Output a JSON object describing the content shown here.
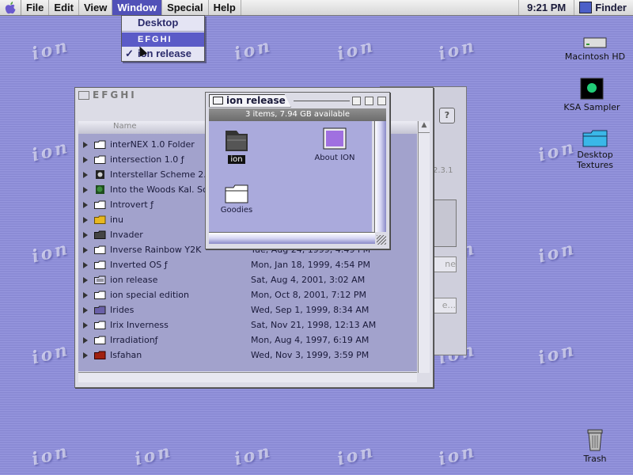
{
  "menubar": {
    "items": [
      "File",
      "Edit",
      "View",
      "Window",
      "Special",
      "Help"
    ],
    "clock": "9:21 PM",
    "app": "Finder"
  },
  "window_menu": {
    "items": [
      "Desktop",
      "EFGHI",
      "ion release"
    ]
  },
  "desktop_icons": [
    "Macintosh HD",
    "KSA Sampler",
    "Desktop Textures",
    "Trash"
  ],
  "wallpaper_text": "ion",
  "efghi_window": {
    "title": "EFGHI",
    "column_name": "Name",
    "rows": [
      {
        "name": "interNEX 1.0 Folder",
        "date": ""
      },
      {
        "name": "intersection 1.0 ƒ",
        "date": ""
      },
      {
        "name": "Interstellar Scheme 2.0",
        "date": ""
      },
      {
        "name": "Into the Woods Kal. Sche",
        "date": ""
      },
      {
        "name": "Introvert ƒ",
        "date": ""
      },
      {
        "name": "inu",
        "date": ""
      },
      {
        "name": "Invader",
        "date": ""
      },
      {
        "name": "Inverse Rainbow Y2K",
        "date": "Tue, Aug 24, 1999, 4:49 PM"
      },
      {
        "name": "Inverted OS ƒ",
        "date": "Mon, Jan 18, 1999, 4:54 PM"
      },
      {
        "name": "ion release",
        "date": "Sat, Aug 4, 2001, 3:02 AM"
      },
      {
        "name": "ion special edition",
        "date": "Mon, Oct 8, 2001, 7:12 PM"
      },
      {
        "name": "Irides",
        "date": "Wed, Sep 1, 1999, 8:34 AM"
      },
      {
        "name": "Irix Inverness",
        "date": "Sat, Nov 21, 1998, 12:13 AM"
      },
      {
        "name": "Irradiationƒ",
        "date": "Mon, Aug 4, 1997, 6:19 AM"
      },
      {
        "name": "Isfahan",
        "date": "Wed, Nov 3, 1999, 3:59 PM"
      }
    ]
  },
  "behind_window": {
    "version": "2.3.1",
    "btn1": "ne",
    "btn2": "e..."
  },
  "ion_window": {
    "title": "ion release",
    "info": "3 items, 7.94 GB available",
    "items": [
      "ion",
      "About ION",
      "Goodies"
    ]
  }
}
